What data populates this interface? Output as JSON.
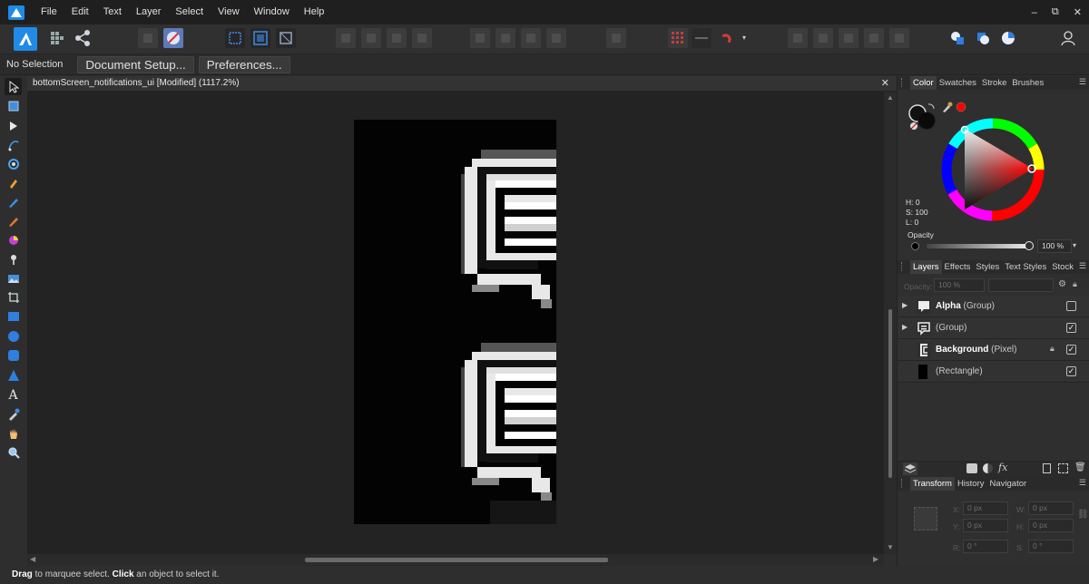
{
  "menubar": {
    "items": [
      "File",
      "Edit",
      "Text",
      "Layer",
      "Select",
      "View",
      "Window",
      "Help"
    ],
    "window_controls": [
      "–",
      "⧉",
      "✕"
    ]
  },
  "context": {
    "selection_label": "No Selection",
    "document_setup_label": "Document Setup...",
    "preferences_label": "Preferences..."
  },
  "document": {
    "title": "bottomScreen_notifications_ui [Modified] (1117.2%)",
    "close": "✕"
  },
  "color_panel": {
    "tabs": [
      "Color",
      "Swatches",
      "Stroke",
      "Brushes"
    ],
    "h": "H: 0",
    "s": "S: 100",
    "l": "L: 0",
    "opacity_label": "Opacity",
    "opacity_value": "100 %",
    "accent": "#ff0000"
  },
  "layers_panel": {
    "tabs": [
      "Layers",
      "Effects",
      "Styles",
      "Text Styles",
      "Stock"
    ],
    "opacity_label": "Opacity:",
    "opacity_value": "100 %",
    "rows": [
      {
        "name": "Alpha",
        "type": " (Group)",
        "checked": ""
      },
      {
        "name": "",
        "type": "(Group)",
        "checked": "✓"
      },
      {
        "name": "Background",
        "type": " (Pixel)",
        "checked": "✓"
      },
      {
        "name": "",
        "type": "(Rectangle)",
        "checked": "✓"
      }
    ]
  },
  "transform_panel": {
    "tabs": [
      "Transform",
      "History",
      "Navigator"
    ],
    "x_label": "X:",
    "x_value": "0 px",
    "y_label": "Y:",
    "y_value": "0 px",
    "w_label": "W:",
    "w_value": "0 px",
    "h_label": "H:",
    "h_value": "0 px",
    "r_label": "R:",
    "r_value": "0 °",
    "s_label": "S:",
    "s_value": "0 °"
  },
  "status": {
    "drag": "Drag",
    "mid": " to marquee select. ",
    "click": "Click",
    "end": " an object to select it."
  }
}
